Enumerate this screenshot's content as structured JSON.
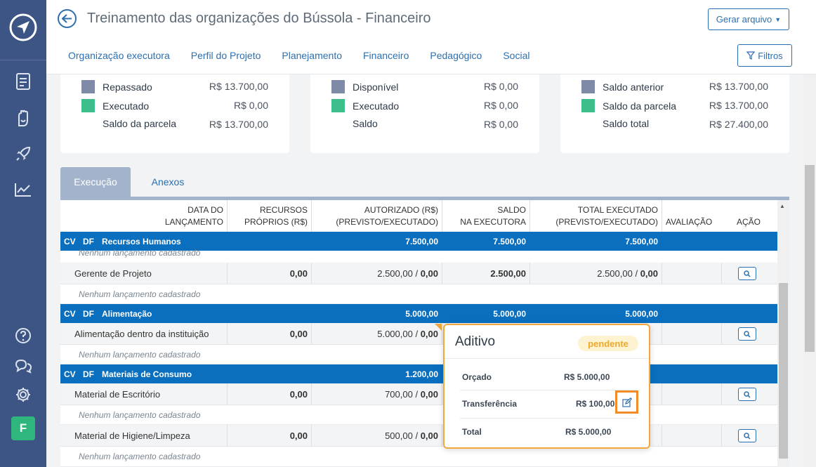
{
  "header": {
    "title": "Treinamento das organizações do Bússola - Financeiro",
    "generate_label": "Gerar arquivo",
    "filters_label": "Filtros"
  },
  "nav": {
    "items": [
      "Organização executora",
      "Perfil do Projeto",
      "Planejamento",
      "Financeiro",
      "Pedagógico",
      "Social"
    ]
  },
  "sidebar": {
    "icons": [
      "document-icon",
      "hand-heart-icon",
      "rocket-icon",
      "chart-line-icon",
      "help-icon",
      "chat-icon",
      "gear-icon"
    ],
    "avatar_letter": "F"
  },
  "summary": {
    "card1": {
      "rows": [
        {
          "label": "Repassado",
          "value": "R$ 13.700,00",
          "color": "#7f8aa6"
        },
        {
          "label": "Executado",
          "value": "R$ 0,00",
          "color": "#3cbf8a"
        },
        {
          "label": "Saldo da parcela",
          "value": "R$ 13.700,00",
          "color": ""
        }
      ]
    },
    "card2": {
      "rows": [
        {
          "label": "Disponível",
          "value": "R$ 0,00",
          "color": "#7f8aa6"
        },
        {
          "label": "Executado",
          "value": "R$ 0,00",
          "color": "#3cbf8a"
        },
        {
          "label": "Saldo",
          "value": "R$ 0,00",
          "color": ""
        }
      ]
    },
    "card3": {
      "rows": [
        {
          "label": "Saldo anterior",
          "value": "R$ 13.700,00",
          "color": "#7f8aa6"
        },
        {
          "label": "Saldo da parcela",
          "value": "R$ 13.700,00",
          "color": "#3cbf8a"
        },
        {
          "label": "Saldo total",
          "value": "R$ 27.400,00",
          "color": ""
        }
      ]
    }
  },
  "tabs": {
    "execucao": "Execução",
    "anexos": "Anexos"
  },
  "table": {
    "headers": {
      "data_l1": "DATA DO",
      "data_l2": "LANÇAMENTO",
      "recursos_l1": "RECURSOS",
      "recursos_l2": "PRÓPRIOS (R$)",
      "autorizado_l1": "AUTORIZADO (R$)",
      "autorizado_l2": "(PREVISTO/EXECUTADO)",
      "saldo_l1": "SALDO",
      "saldo_l2": "NA EXECUTORA",
      "total_l1": "TOTAL EXECUTADO",
      "total_l2": "(PREVISTO/EXECUTADO)",
      "avaliacao": "AVALIAÇÃO",
      "acao": "AÇÃO"
    },
    "cv": "CV",
    "df": "DF",
    "empty_text": "Nenhum lançamento cadastrado",
    "groups": [
      {
        "name": "Recursos Humanos",
        "autorizado": "7.500,00",
        "saldo": "7.500,00",
        "total": "7.500,00"
      },
      {
        "name": "Alimentação",
        "autorizado": "5.000,00",
        "saldo": "5.000,00",
        "total": "5.000,00"
      },
      {
        "name": "Materiais de Consumo",
        "autorizado": "1.200,00",
        "saldo": "",
        "total": ""
      }
    ],
    "items": [
      {
        "name": "Gerente de Projeto",
        "recursos": "0,00",
        "autorizado_prev": "2.500,00 / ",
        "autorizado_exec": "0,00",
        "saldo": "2.500,00",
        "total_prev": "2.500,00 / ",
        "total_exec": "0,00"
      },
      {
        "name": "Alimentação dentro da instituição",
        "recursos": "0,00",
        "autorizado_prev": "5.000,00 / ",
        "autorizado_exec": "0,00",
        "saldo": "",
        "total_prev": "",
        "total_exec": ""
      },
      {
        "name": "Material de Escritório",
        "recursos": "0,00",
        "autorizado_prev": "700,00 / ",
        "autorizado_exec": "0,00",
        "saldo": "",
        "total_prev": "",
        "total_exec": ""
      },
      {
        "name": "Material de Higiene/Limpeza",
        "recursos": "0,00",
        "autorizado_prev": "500,00 / ",
        "autorizado_exec": "0,00",
        "saldo": "",
        "total_prev": "",
        "total_exec": ""
      }
    ]
  },
  "popover": {
    "title": "Aditivo",
    "status": "pendente",
    "orcado_label": "Orçado",
    "orcado_value": "R$ 5.000,00",
    "transferencia_label": "Transferência",
    "transferencia_value": "R$ 100,00",
    "total_label": "Total",
    "total_value": "R$ 5.000,00"
  }
}
